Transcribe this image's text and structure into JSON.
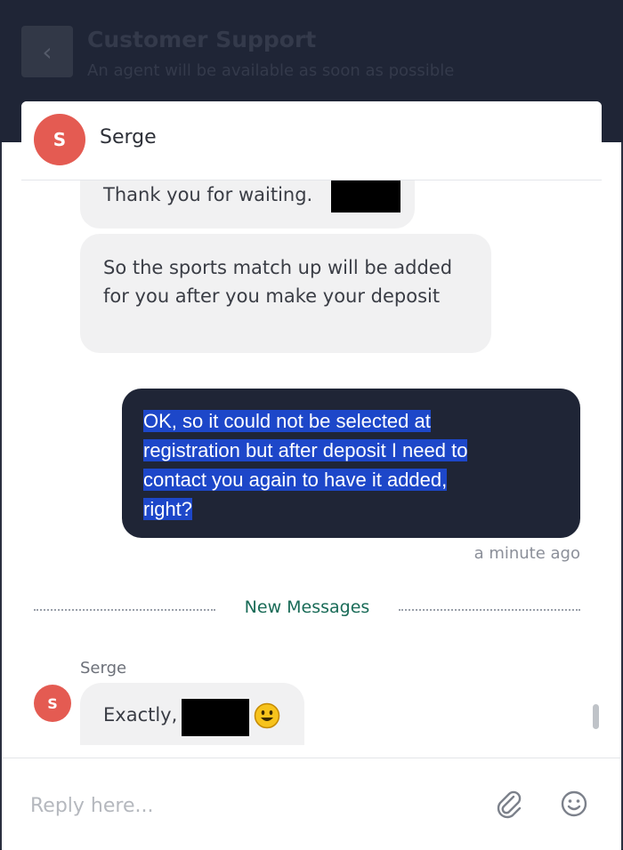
{
  "header": {
    "title": "Customer Support",
    "subtitle": "An agent will be available as soon as possible",
    "back_glyph": "‹"
  },
  "agent": {
    "name": "Serge",
    "initial": "S"
  },
  "messages": {
    "agent_1": "Thank you for waiting.",
    "agent_2": "So the sports match up will be added for you after you make your deposit",
    "own_lines": [
      "OK, so it could not be selected at",
      "registration but after deposit I need to",
      "contact you again to have it added,",
      "right?"
    ],
    "own_time": "a minute ago",
    "new_messages_label": "New Messages",
    "sender": "Serge",
    "agent_3": "Exactly,"
  },
  "reply": {
    "placeholder": "Reply here...",
    "value": ""
  },
  "icons": {
    "back": "chevron-left-icon",
    "attach": "paperclip-icon",
    "emoji": "smiley-icon"
  },
  "colors": {
    "header_bg": "#1f2536",
    "avatar": "#e45b52",
    "selection": "#1d47c9",
    "new_messages": "#196b57"
  }
}
